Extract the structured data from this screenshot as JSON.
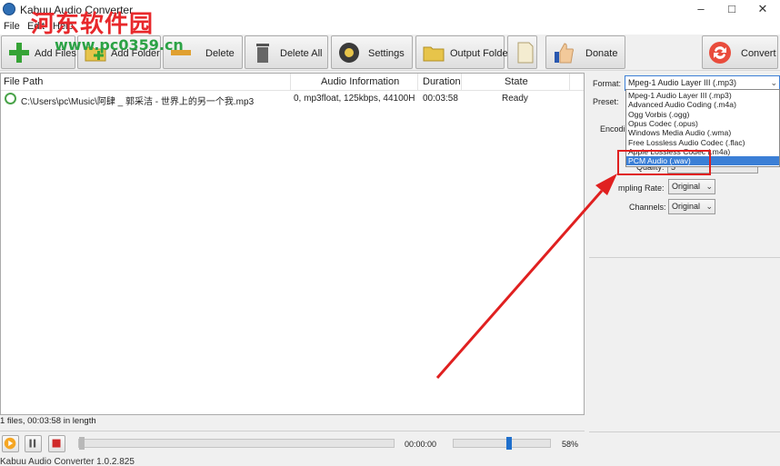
{
  "window": {
    "title": "Kabuu Audio Converter",
    "min_glyph": "–",
    "max_glyph": "□",
    "close_glyph": "✕"
  },
  "watermark": {
    "text": "河东软件园",
    "sub": "www.pc0359.cn"
  },
  "menu": [
    {
      "label": "File"
    },
    {
      "label": "Edit"
    },
    {
      "label": "Help"
    }
  ],
  "toolbar": {
    "add_files": "Add Files",
    "add_folder": "Add Folder",
    "delete": "Delete",
    "delete_all": "Delete All",
    "settings": "Settings",
    "output_folder": "Output Folder",
    "donate": "Donate",
    "convert": "Convert"
  },
  "filelist": {
    "columns": [
      "File Path",
      "Audio Information",
      "Duration",
      "State"
    ],
    "rows": [
      {
        "path": "C:\\Users\\pc\\Music\\阿肆 _ 郭采洁 - 世界上的另一个我.mp3",
        "info": "0, mp3float, 125kbps, 44100H...",
        "duration": "00:03:58",
        "state": "Ready"
      }
    ]
  },
  "panel": {
    "format_label": "Format:",
    "format_value": "Mpeg-1 Audio Layer III (.mp3)",
    "preset_label": "Preset:",
    "encoding_label": "Encodi",
    "quality_label": "Quality:",
    "quality_value": "5",
    "sampling_label": "mpling Rate:",
    "sampling_value": "Original",
    "channels_label": "Channels:",
    "channels_value": "Original",
    "options": [
      "Mpeg-1 Audio Layer III (.mp3)",
      "Advanced Audio Coding (.m4a)",
      "Ogg Vorbis (.ogg)",
      "Opus Codec (.opus)",
      "Windows Media Audio (.wma)",
      "Free Lossless Audio Codec (.flac)",
      "Apple Lossless Codec (.m4a)",
      "PCM Audio (.wav)"
    ],
    "selected_option_index": 7
  },
  "status": {
    "text": "1 files, 00:03:58 in length"
  },
  "player": {
    "time": "00:00:00",
    "volume_pct": "58%",
    "volume_level": 0.58,
    "seek_level": 0.0
  },
  "footer": {
    "version": "Kabuu Audio Converter 1.0.2.825"
  },
  "colors": {
    "accent": "#3b7fd6",
    "annotation_red": "#e02020",
    "watermark_red": "#e8282b",
    "watermark_green": "#2ba245"
  }
}
